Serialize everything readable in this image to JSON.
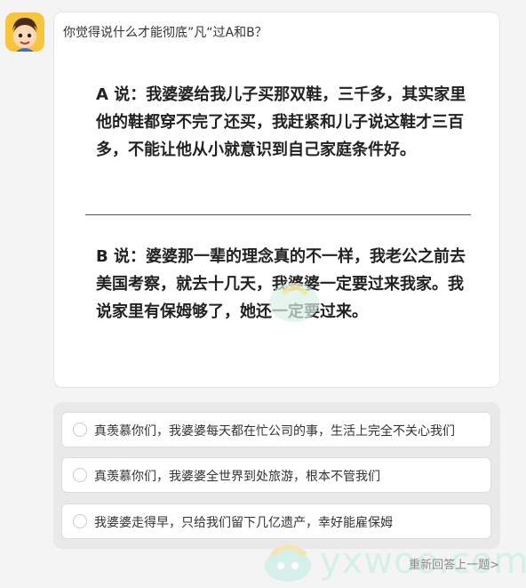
{
  "question": "你觉得说什么才能彻底”凡“过A和B？",
  "statement_a": "A 说：我婆婆给我儿子买那双鞋，三千多，其实家里他的鞋都穿不完了还买，我赶紧和儿子说这鞋才三百多，不能让他从小就意识到自己家庭条件好。",
  "statement_b": "B 说：婆婆那一辈的理念真的不一样，我老公之前去美国考察，就去十几天，我婆婆一定要过来我家。我说家里有保姆够了，她还一定要过来。",
  "options": [
    {
      "label": "真羡慕你们，我婆婆每天都在忙公司的事，生活上完全不关心我们"
    },
    {
      "label": "真羡慕你们，我婆婆全世界到处旅游，根本不管我们"
    },
    {
      "label": "我婆婆走得早，只给我们留下几亿遗产，幸好能雇保姆"
    }
  ],
  "redo_label": "重新回答上一题>",
  "watermark_text": "yxwoo.com",
  "colors": {
    "avatar_bg": "#f7c53b",
    "watermark": "#d5f0e9",
    "panel": "#e9e9e9"
  }
}
